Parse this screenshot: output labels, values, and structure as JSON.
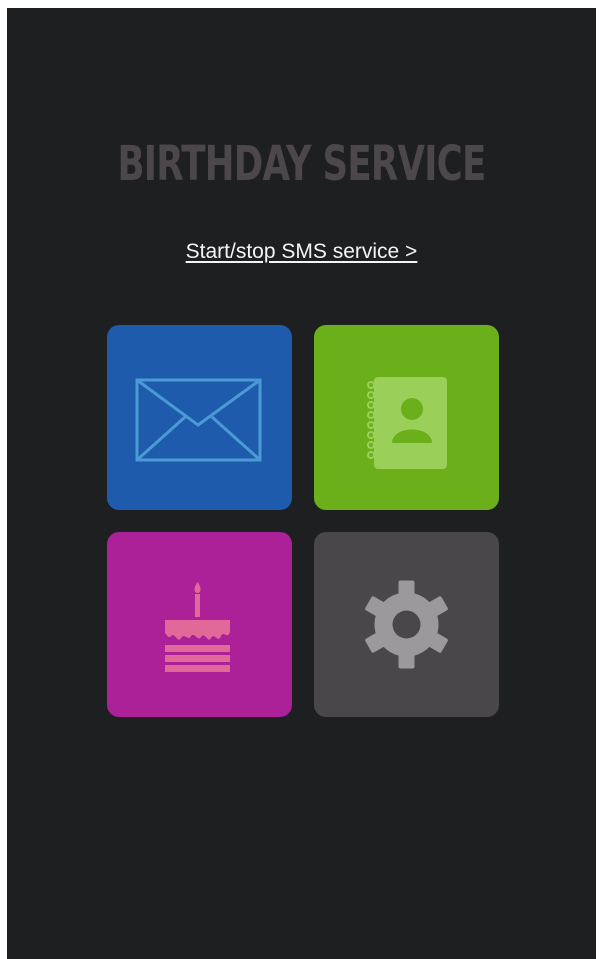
{
  "app": {
    "title": "BIRTHDAY SERVICE",
    "sms_link_label": "Start/stop SMS service >"
  },
  "tiles": [
    {
      "id": "messages",
      "icon": "envelope-icon",
      "color": "#1f5bac",
      "icon_color": "#4a9ad6"
    },
    {
      "id": "contacts",
      "icon": "contact-book-icon",
      "color": "#6bb01b",
      "icon_color": "#9ad05a"
    },
    {
      "id": "birthdays",
      "icon": "birthday-cake-icon",
      "color": "#ac2198",
      "icon_color": "#e0699a"
    },
    {
      "id": "settings",
      "icon": "gear-icon",
      "color": "#4a474a",
      "icon_color": "#9b999b"
    }
  ],
  "colors": {
    "background": "#1e1f21",
    "title": "#4b474b",
    "link": "#f4f4f4"
  }
}
